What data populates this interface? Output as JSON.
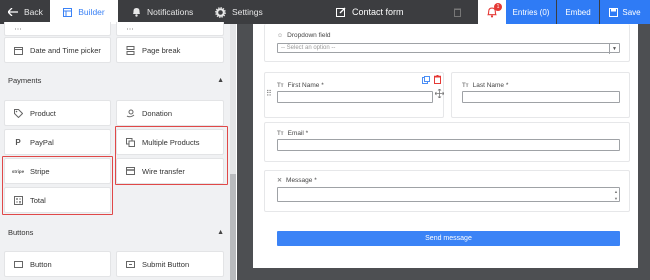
{
  "topbar": {
    "back_label": "Back",
    "builder_label": "Builder",
    "notifications_label": "Notifications",
    "settings_label": "Settings",
    "form_title": "Contact form",
    "bell_badge": "1",
    "entries_label": "Entries (0)",
    "embed_label": "Embed",
    "save_label": "Save"
  },
  "sidebar": {
    "top_items": [
      {
        "label": "Date and Time picker",
        "icon": "calendar-icon"
      },
      {
        "label": "Page break",
        "icon": "page-break-icon"
      }
    ],
    "payments": {
      "title": "Payments",
      "items": [
        {
          "label": "Product",
          "icon": "tag-icon"
        },
        {
          "label": "Donation",
          "icon": "donation-icon"
        },
        {
          "label": "PayPal",
          "icon": "paypal-icon"
        },
        {
          "label": "Multiple Products",
          "icon": "multiple-products-icon"
        },
        {
          "label": "Stripe",
          "icon": "stripe-icon"
        },
        {
          "label": "Wire transfer",
          "icon": "card-icon"
        },
        {
          "label": "Total",
          "icon": "calculator-icon"
        }
      ]
    },
    "buttons": {
      "title": "Buttons",
      "items": [
        {
          "label": "Button",
          "icon": "button-icon"
        },
        {
          "label": "Submit Button",
          "icon": "submit-icon"
        }
      ]
    }
  },
  "form": {
    "dropdown": {
      "label": "Dropdown field",
      "placeholder": "-- Select an option --"
    },
    "first_name": {
      "label": "First Name *"
    },
    "last_name": {
      "label": "Last Name *"
    },
    "email": {
      "label": "Email *"
    },
    "message": {
      "label": "Message *"
    },
    "submit_label": "Send message"
  },
  "colors": {
    "accent": "#3b83f6",
    "topbar_bg": "#3c3d40",
    "highlight": "#e04848"
  }
}
